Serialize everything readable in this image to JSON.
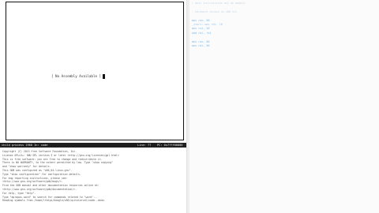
{
  "asm_window": {
    "message": "[ No Assembly Available ]"
  },
  "status_bar": {
    "left": "child process 1960 In: code",
    "lines": "Line: ??",
    "pc": "PC: 0x7fff00000"
  },
  "console": {
    "lines": [
      "Copyright (C) 2013 Free Software Foundation, Inc.",
      "License GPLv3+: GNU GPL version 3 or later <http://gnu.org/licenses/gpl.html>",
      "This is free software: you are free to change and redistribute it.",
      "There is NO WARRANTY, to the extent permitted by law.  Type \"show copying\"",
      "and \"show warranty\" for details.",
      "This GDB was configured as \"x86_64-linux-gnu\".",
      "Type \"show configuration\" for configuration details.",
      "For bug reporting instructions, please see:",
      "<http://www.gnu.org/software/gdb/bugs/>.",
      "Find the GDB manual and other documentation resources online at:",
      "<http://www.gnu.org/software/gdb/documentation/>.",
      "For help, type \"help\".",
      "Type \"apropos word\" to search for commands related to \"word\"...",
      "Reading symbols from /home/lfatyo/Google/x86/cpitutorial/code..done."
    ]
  },
  "editor": {
    "lines": [
      {
        "text": "; most instructions act on memory",
        "class": "c-comment"
      },
      {
        "text": "",
        "class": ""
      },
      {
        "text": "  ; hardware access on x86 etc.",
        "class": "c-comment"
      },
      {
        "text": "",
        "class": ""
      },
      {
        "text": "        mov rax, 60",
        "class": "c-kw"
      },
      {
        "text": "_start: mov rdi, 10",
        "class": "c-label"
      },
      {
        "text": "        mov rsi, 20",
        "class": "c-kw"
      },
      {
        "text": "        add rdi, rsi",
        "class": "c-kw"
      },
      {
        "text": "",
        "class": ""
      },
      {
        "text": "        mov rax, 60",
        "class": "c-kw"
      },
      {
        "text": "        mov rdi, 00",
        "class": "c-kw"
      }
    ]
  }
}
